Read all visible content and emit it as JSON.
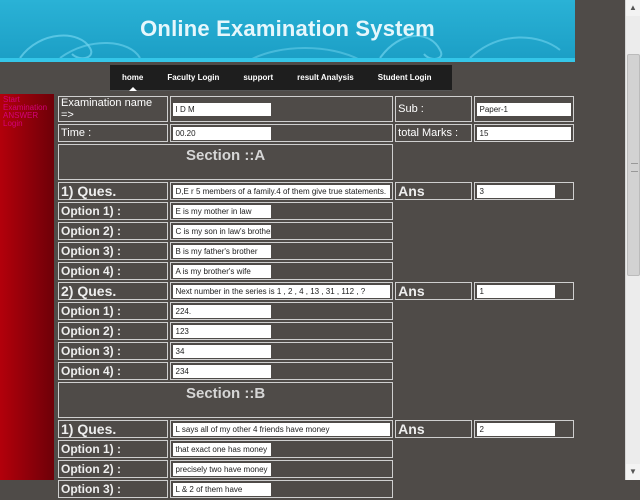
{
  "site_title": "Online Examination System",
  "nav": [
    "home",
    "Faculty Login",
    "support",
    "result Analysis",
    "Student Login"
  ],
  "sidebar_links": [
    "Start",
    "Examination",
    "ANSWER",
    "Login"
  ],
  "exam": {
    "name_label": "Examination name =>",
    "name_value": "I D M",
    "sub_label": "Sub :",
    "sub_value": "Paper-1",
    "time_label": "Time :",
    "time_value": "00.20",
    "marks_label": "total Marks :",
    "marks_value": "15"
  },
  "sections": [
    {
      "title": "Section ::A",
      "questions": [
        {
          "label": "1) Ques.",
          "text": "D,E r 5 members of a family.4 of them give true statements.",
          "ans_label": "Ans",
          "ans_value": "3",
          "options": [
            {
              "label": "Option 1) :",
              "value": "E is my mother in law"
            },
            {
              "label": "Option 2) :",
              "value": "C is my son in law's brother"
            },
            {
              "label": "Option 3) :",
              "value": "B is my father's brother"
            },
            {
              "label": "Option 4) :",
              "value": "A is my brother's wife"
            }
          ]
        },
        {
          "label": "2) Ques.",
          "text": "Next number in the series is 1 , 2 , 4 , 13 , 31 , 112 , ?",
          "ans_label": "Ans",
          "ans_value": "1",
          "options": [
            {
              "label": "Option 1) :",
              "value": "224."
            },
            {
              "label": "Option 2) :",
              "value": "123"
            },
            {
              "label": "Option 3) :",
              "value": "34"
            },
            {
              "label": "Option 4) :",
              "value": "234"
            }
          ]
        }
      ]
    },
    {
      "title": "Section ::B",
      "questions": [
        {
          "label": "1) Ques.",
          "text": "L says all of my other 4 friends have money",
          "ans_label": "Ans",
          "ans_value": "2",
          "options": [
            {
              "label": "Option 1) :",
              "value": "that exact one has money"
            },
            {
              "label": "Option 2) :",
              "value": "precisely two have money"
            },
            {
              "label": "Option 3) :",
              "value": "L & 2 of them have"
            }
          ]
        }
      ]
    }
  ]
}
